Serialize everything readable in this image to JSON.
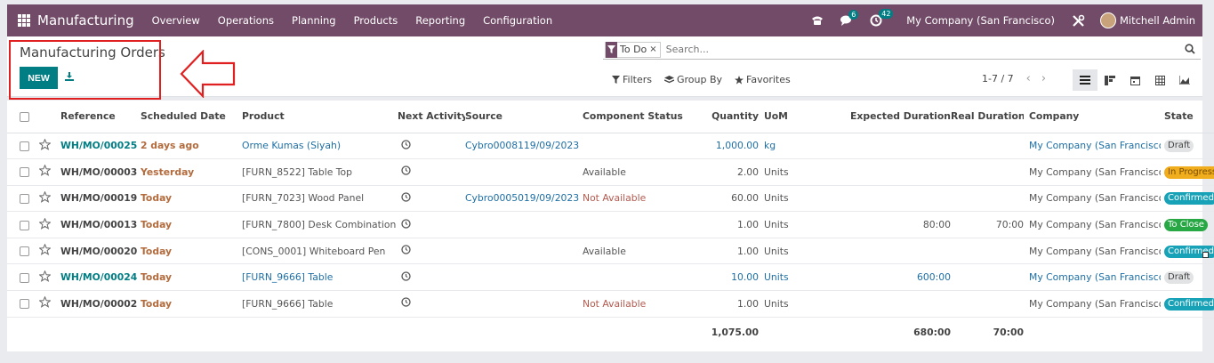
{
  "navbar": {
    "app_title": "Manufacturing",
    "menu": [
      "Overview",
      "Operations",
      "Planning",
      "Products",
      "Reporting",
      "Configuration"
    ],
    "messages_count": "6",
    "activities_count": "42",
    "company": "My Company (San Francisco)",
    "user": "Mitchell Admin"
  },
  "panel": {
    "title": "Manufacturing Orders",
    "new_label": "NEW",
    "facet_label": "To Do",
    "facet_close": "×",
    "search_placeholder": "Search...",
    "filters_label": "Filters",
    "groupby_label": "Group By",
    "favorites_label": "Favorites",
    "pager": "1-7 / 7"
  },
  "table": {
    "headers": {
      "reference": "Reference",
      "scheduled_date": "Scheduled Date",
      "product": "Product",
      "next_activity": "Next Activity",
      "source": "Source",
      "component_status": "Component Status",
      "quantity": "Quantity",
      "uom": "UoM",
      "expected_duration": "Expected Duration",
      "real_duration": "Real Duration",
      "company": "Company",
      "state": "State"
    },
    "rows": [
      {
        "reference": "WH/MO/00025",
        "date": "2 days ago",
        "product": "Orme Kumas (Siyah)",
        "source": "Cybro0008119/09/2023",
        "component": "",
        "quantity": "1,000.00",
        "uom": "kg",
        "expected": "",
        "real": "",
        "company": "My Company (San Francisco)",
        "state": "Draft"
      },
      {
        "reference": "WH/MO/00003",
        "date": "Yesterday",
        "product": "[FURN_8522] Table Top",
        "source": "",
        "component": "Available",
        "quantity": "2.00",
        "uom": "Units",
        "expected": "",
        "real": "",
        "company": "My Company (San Francisco)",
        "state": "In Progress"
      },
      {
        "reference": "WH/MO/00019",
        "date": "Today",
        "product": "[FURN_7023] Wood Panel",
        "source": "Cybro0005019/09/2023",
        "component": "Not Available",
        "quantity": "60.00",
        "uom": "Units",
        "expected": "",
        "real": "",
        "company": "My Company (San Francisco)",
        "state": "Confirmed"
      },
      {
        "reference": "WH/MO/00013",
        "date": "Today",
        "product": "[FURN_7800] Desk Combination",
        "source": "",
        "component": "",
        "quantity": "1.00",
        "uom": "Units",
        "expected": "80:00",
        "real": "70:00",
        "company": "My Company (San Francisco)",
        "state": "To Close"
      },
      {
        "reference": "WH/MO/00020",
        "date": "Today",
        "product": "[CONS_0001] Whiteboard Pen",
        "source": "",
        "component": "Available",
        "quantity": "1.00",
        "uom": "Units",
        "expected": "",
        "real": "",
        "company": "My Company (San Francisco)",
        "state": "Confirmed"
      },
      {
        "reference": "WH/MO/00024",
        "date": "Today",
        "product": "[FURN_9666] Table",
        "source": "",
        "component": "",
        "quantity": "10.00",
        "uom": "Units",
        "expected": "600:00",
        "real": "",
        "company": "My Company (San Francisco)",
        "state": "Draft"
      },
      {
        "reference": "WH/MO/00002",
        "date": "Today",
        "product": "[FURN_9666] Table",
        "source": "",
        "component": "Not Available",
        "quantity": "1.00",
        "uom": "Units",
        "expected": "",
        "real": "",
        "company": "My Company (San Francisco)",
        "state": "Confirmed"
      }
    ],
    "totals": {
      "quantity": "1,075.00",
      "expected": "680:00",
      "real": "70:00"
    }
  },
  "colors": {
    "brand": "#714b67",
    "primary": "#017e84",
    "annotation": "#e02020"
  }
}
